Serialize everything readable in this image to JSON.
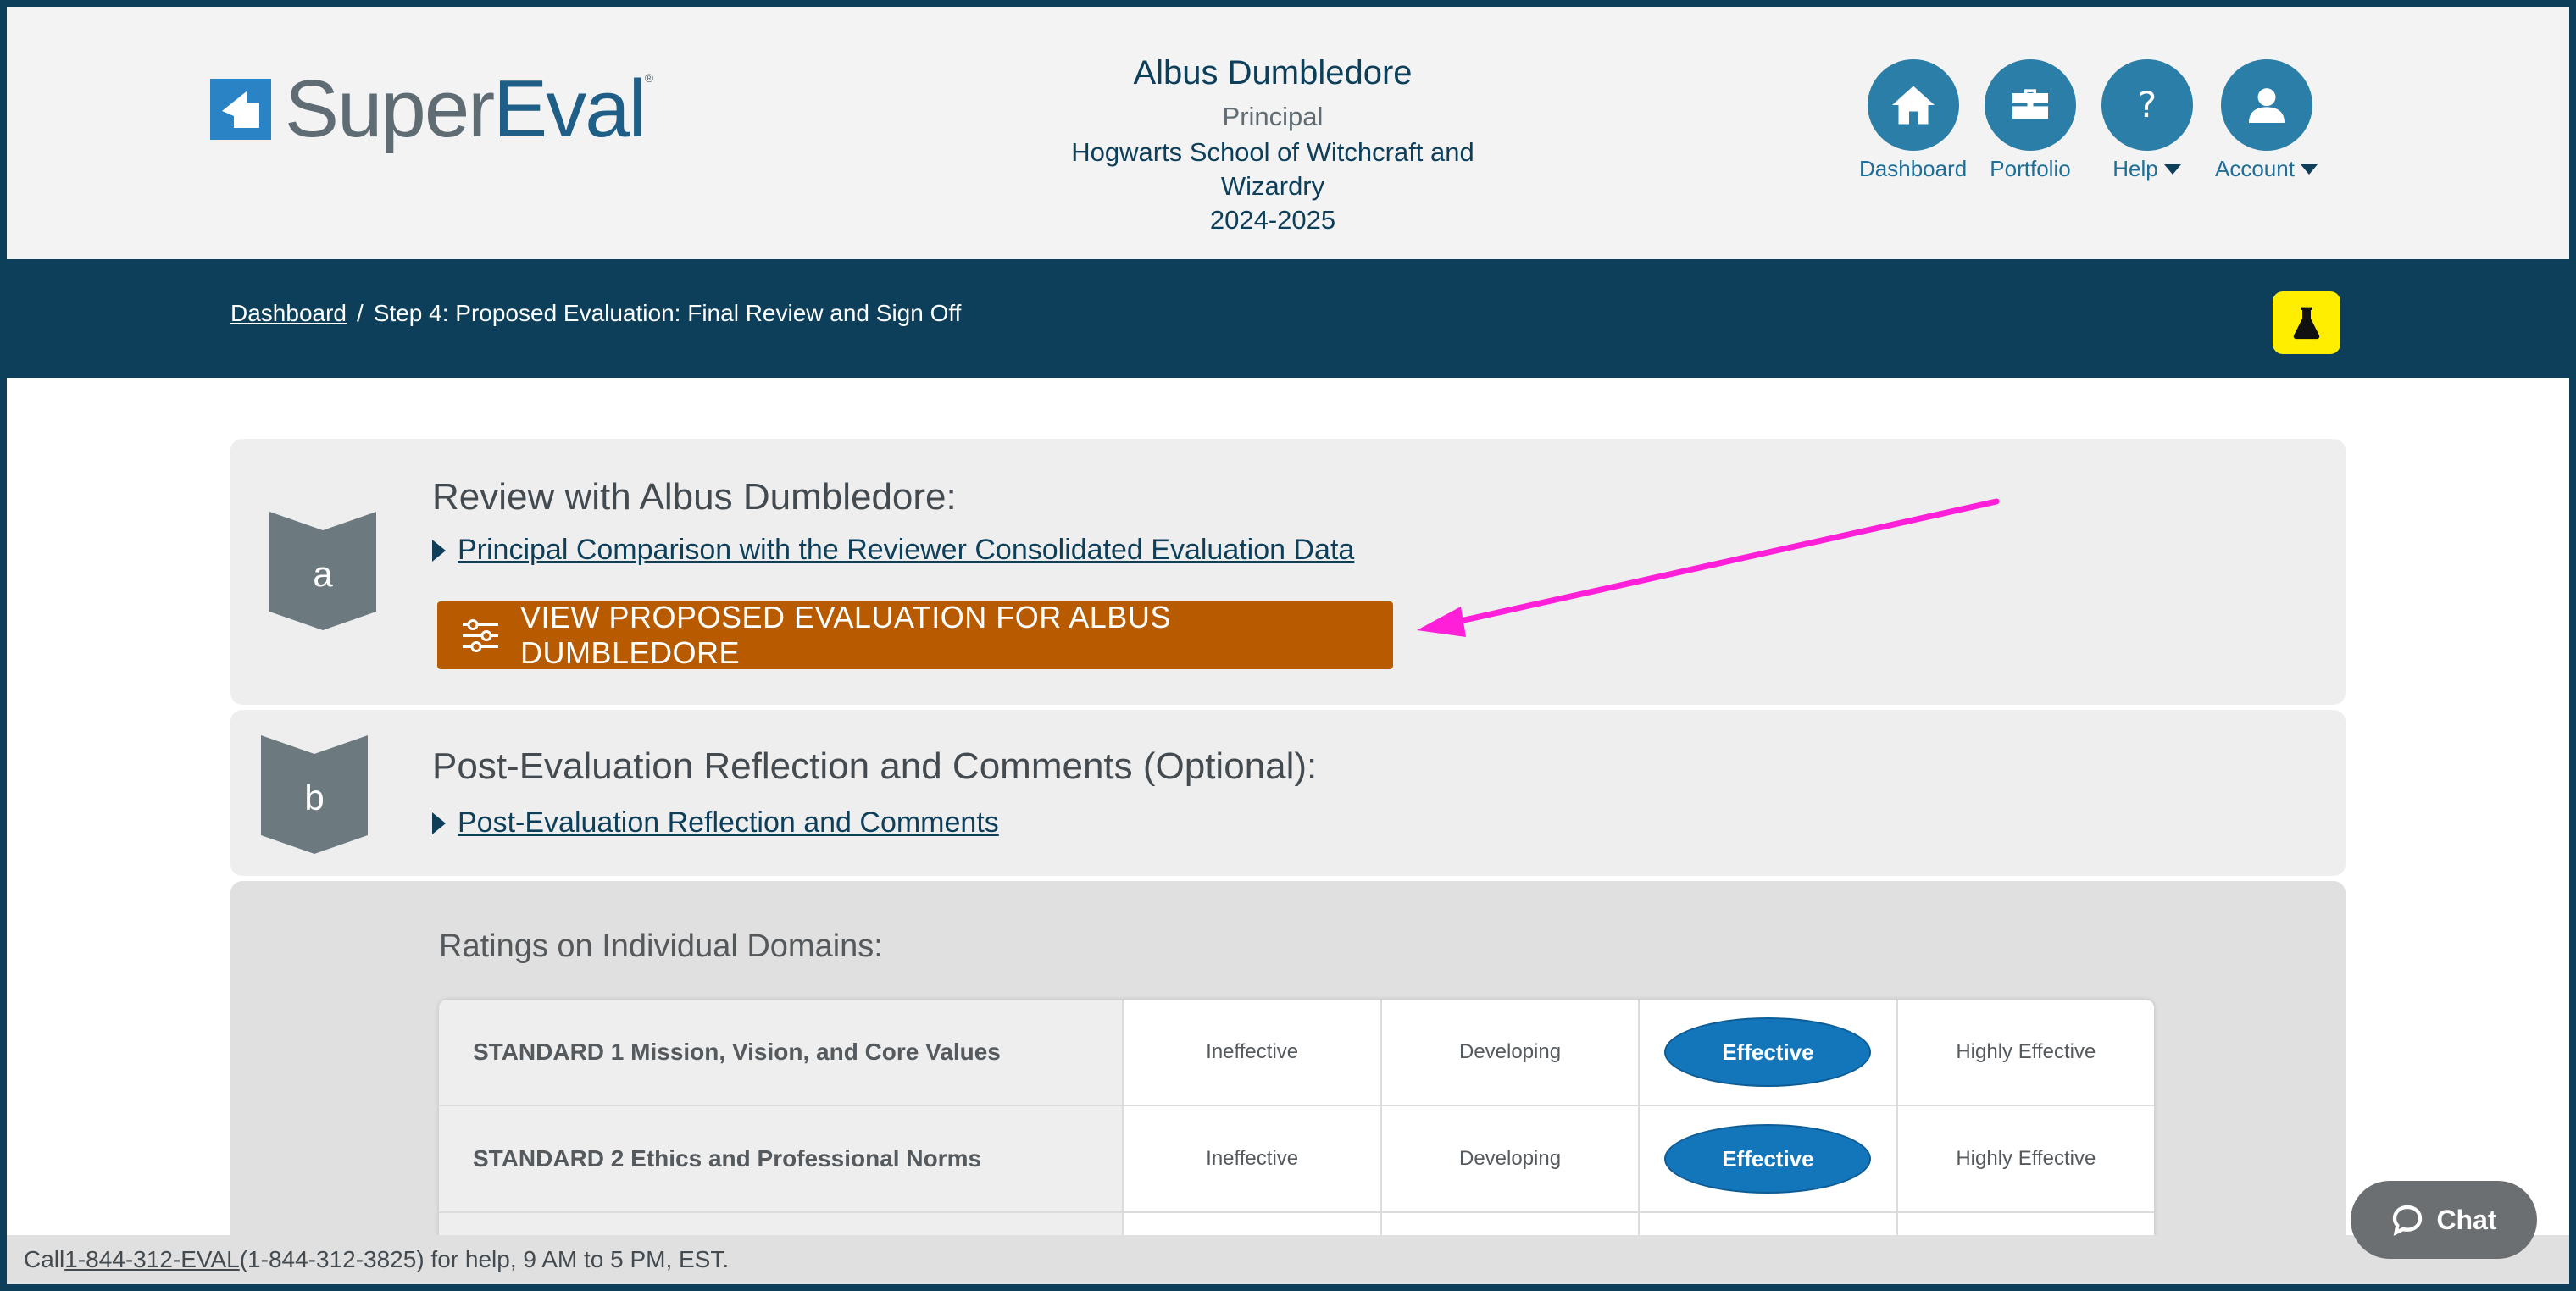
{
  "brand": {
    "name_light": "Super",
    "name_bold": "Eval",
    "mark": "®"
  },
  "user": {
    "name": "Albus Dumbledore",
    "role": "Principal",
    "school": "Hogwarts School of Witchcraft and Wizardry",
    "year": "2024-2025"
  },
  "nav": [
    {
      "label": "Dashboard",
      "icon": "home-icon"
    },
    {
      "label": "Portfolio",
      "icon": "briefcase-icon"
    },
    {
      "label": "Help",
      "icon": "question-icon"
    },
    {
      "label": "Account",
      "icon": "user-icon"
    }
  ],
  "breadcrumb": {
    "home": "Dashboard",
    "separator": "/",
    "current": "Step 4: Proposed Evaluation: Final Review and Sign Off"
  },
  "section_a": {
    "letter": "a",
    "title": "Review with Albus Dumbledore:",
    "link": "Principal Comparison with the Reviewer Consolidated Evaluation Data",
    "button": "VIEW PROPOSED EVALUATION FOR ALBUS DUMBLEDORE"
  },
  "section_b": {
    "letter": "b",
    "title": "Post-Evaluation Reflection and Comments (Optional):",
    "link": "Post-Evaluation Reflection and Comments"
  },
  "ratings": {
    "title": "Ratings on Individual Domains:",
    "levels": [
      "Ineffective",
      "Developing",
      "Effective",
      "Highly Effective"
    ],
    "rows": [
      {
        "standard": "STANDARD 1 Mission, Vision, and Core Values",
        "selected": "Effective"
      },
      {
        "standard": "STANDARD 2 Ethics and Professional Norms",
        "selected": "Effective"
      }
    ]
  },
  "footer": {
    "prefix": "Call ",
    "phone_link": "1-844-312-EVAL",
    "suffix": " (1-844-312-3825) for help, 9 AM to 5 PM, EST."
  },
  "chat": {
    "label": "Chat"
  },
  "colors": {
    "navy": "#0d3f5a",
    "nav_blue": "#2a7ea7",
    "orange": "#b85b00",
    "selected_pill": "#1476ba",
    "annotation_arrow": "#ff1fd8",
    "highlight_button": "#ffee00"
  }
}
